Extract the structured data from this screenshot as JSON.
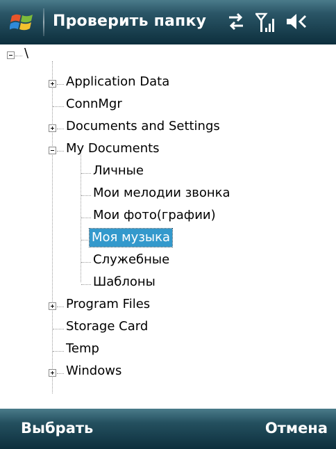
{
  "title_bar": {
    "title": "Проверить папку",
    "icons": [
      "windows-start-logo",
      "connectivity-icon",
      "signal-strength-icon",
      "speaker-volume-icon"
    ]
  },
  "tree": {
    "root": {
      "label": "\\",
      "expanded": true
    },
    "items": [
      {
        "label": "Application Data",
        "expander": "plus"
      },
      {
        "label": "ConnMgr",
        "expander": "none"
      },
      {
        "label": "Documents and Settings",
        "expander": "plus"
      },
      {
        "label": "My Documents",
        "expander": "minus",
        "children": [
          {
            "label": "Личные"
          },
          {
            "label": "Мои мелодии звонка"
          },
          {
            "label": "Мои фото(графии)"
          },
          {
            "label": "Моя музыка",
            "selected": true
          },
          {
            "label": "Служебные"
          },
          {
            "label": "Шаблоны"
          }
        ]
      },
      {
        "label": "Program Files",
        "expander": "plus"
      },
      {
        "label": "Storage Card",
        "expander": "none"
      },
      {
        "label": "Temp",
        "expander": "none"
      },
      {
        "label": "Windows",
        "expander": "plus"
      }
    ],
    "selection_color": "#3399cc"
  },
  "soft_keys": {
    "left": "Выбрать",
    "right": "Отмена"
  },
  "colors": {
    "bar_top": "#4a7b8a",
    "bar_bottom": "#0d2f3d"
  }
}
